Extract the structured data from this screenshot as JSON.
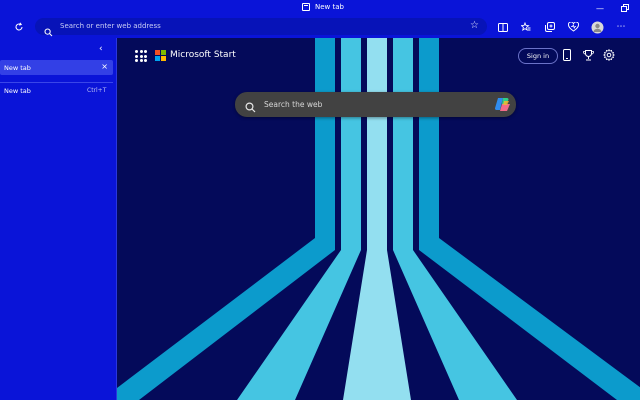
{
  "window": {
    "title": "New tab",
    "tab_icon": "tab-icon",
    "minimize_icon": "minimize-icon",
    "restore_icon": "restore-icon"
  },
  "toolbar": {
    "refresh_icon": "refresh-icon",
    "address_placeholder": "Search or enter web address",
    "favorite_icon": "star-icon",
    "icons": [
      "split-screen-icon",
      "favorites-icon",
      "collections-icon",
      "browser-essentials-icon",
      "profile-avatar",
      "more-icon"
    ]
  },
  "sidebar": {
    "collapse_icon": "chevron-left-icon",
    "active_tab": {
      "label": "New tab",
      "close_icon": "close-icon"
    },
    "new_tab": {
      "label": "New tab",
      "shortcut": "Ctrl+T"
    }
  },
  "content": {
    "brand": "Microsoft Start",
    "apps_icon": "apps-grid-icon",
    "sign_in": "Sign in",
    "header_icons": [
      "mobile-icon",
      "rewards-trophy-icon",
      "settings-gear-icon"
    ],
    "search_placeholder": "Search the web",
    "copilot_icon": "copilot-icon"
  },
  "colors": {
    "chrome": "#0a14d8",
    "address_bar": "#0713b8",
    "content_bg": "#040a5a",
    "search_bg": "#424242",
    "stripe_light": "#93dff0",
    "stripe_mid": "#45c5e2",
    "stripe_dark": "#0c9bcc",
    "ms_red": "#f25022",
    "ms_green": "#7fba00",
    "ms_blue": "#00a4ef",
    "ms_yellow": "#ffb900"
  }
}
